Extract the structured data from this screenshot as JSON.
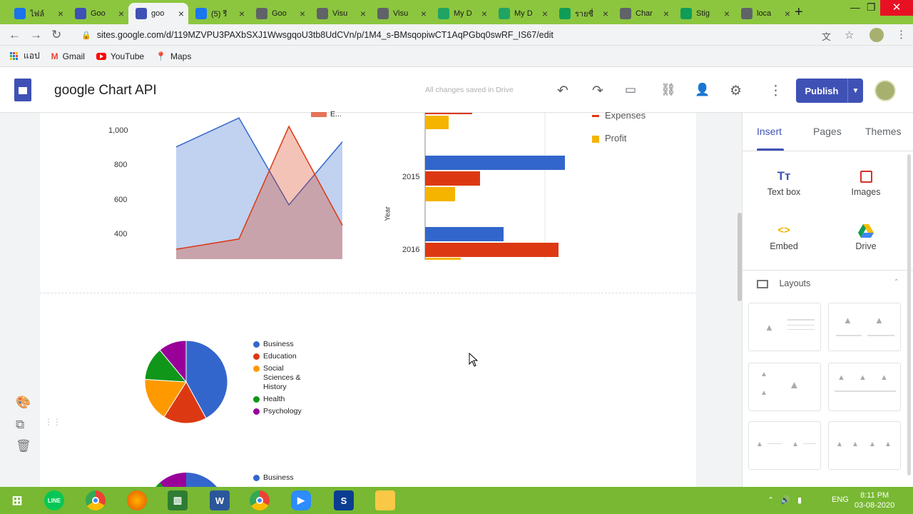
{
  "browser": {
    "tabs": [
      {
        "label": "ไฟล์",
        "fav_color": "#1a73e8",
        "icon": "sites-icon"
      },
      {
        "label": "Goo",
        "fav_color": "#3f51b5",
        "icon": "sites-icon"
      },
      {
        "label": "goo",
        "fav_color": "#3f51b5",
        "icon": "sites-icon",
        "active": true
      },
      {
        "label": "(5) รี",
        "fav_color": "#1877f2",
        "icon": "facebook-icon"
      },
      {
        "label": "Goo",
        "fav_color": "#5f6368",
        "icon": "code-icon"
      },
      {
        "label": "Visu",
        "fav_color": "#5f6368",
        "icon": "code-icon"
      },
      {
        "label": "Visu",
        "fav_color": "#5f6368",
        "icon": "code-icon"
      },
      {
        "label": "My D",
        "fav_color": "#1fa463",
        "icon": "drive-icon"
      },
      {
        "label": "My D",
        "fav_color": "#1fa463",
        "icon": "drive-icon"
      },
      {
        "label": "รายชื่",
        "fav_color": "#0f9d58",
        "icon": "sheets-icon"
      },
      {
        "label": "Char",
        "fav_color": "#5f6368",
        "icon": "code-icon"
      },
      {
        "label": "Stig",
        "fav_color": "#0f9d58",
        "icon": "sheets-icon"
      },
      {
        "label": "loca",
        "fav_color": "#5f6368",
        "icon": "globe-icon"
      }
    ],
    "url": "sites.google.com/d/119MZVPU3PAXbSXJ1WwsgqoU3tb8UdCVn/p/1M4_s-BMsqopiwCT1AqPGbq0swRF_IS67/edit",
    "bookmarks": [
      {
        "label": "แอป"
      },
      {
        "label": "Gmail"
      },
      {
        "label": "YouTube"
      },
      {
        "label": "Maps"
      }
    ]
  },
  "sites": {
    "title": "google Chart API",
    "saved_status": "All changes saved in Drive",
    "publish_label": "Publish"
  },
  "charts": {
    "area_ticks": [
      "1,000",
      "800",
      "600",
      "400"
    ],
    "area_legend_partial": "E...",
    "bar_legend": [
      "Expenses",
      "Profit"
    ],
    "bar_ticks": [
      "2015",
      "2016"
    ],
    "bar_axis_label": "Year",
    "pie_legend": [
      {
        "label": "Business",
        "color": "#3366cc"
      },
      {
        "label": "Education",
        "color": "#dc3912"
      },
      {
        "label": "Social Sciences & History",
        "color": "#ff9900"
      },
      {
        "label": "Health",
        "color": "#109618"
      },
      {
        "label": "Psychology",
        "color": "#990099"
      }
    ],
    "pie2_legend_first": "Business"
  },
  "chart_data": [
    {
      "type": "area",
      "ylim": [
        300,
        1200
      ],
      "x": [
        1,
        2,
        3,
        4,
        5
      ],
      "series": [
        {
          "values": [
            1000,
            1170,
            660,
            1030
          ],
          "color": "#3366cc"
        },
        {
          "values": [
            400,
            460,
            1120,
            540
          ],
          "color": "#dc3912"
        }
      ],
      "legend": [
        "E..."
      ]
    },
    {
      "type": "bar",
      "categories": [
        "2015",
        "2016"
      ],
      "ylabel": "Year",
      "legend": [
        "Expenses",
        "Profit"
      ],
      "series_colors": [
        "#3366cc",
        "#dc3912",
        "#ff9900"
      ]
    },
    {
      "type": "pie",
      "categories": [
        "Business",
        "Education",
        "Social Sciences & History",
        "Health",
        "Psychology"
      ],
      "values": [
        42,
        17,
        17,
        13,
        11
      ]
    }
  ],
  "panel": {
    "tabs": [
      "Insert",
      "Pages",
      "Themes"
    ],
    "items": [
      {
        "label": "Text box",
        "icon": "text-box-icon"
      },
      {
        "label": "Images",
        "icon": "images-icon"
      },
      {
        "label": "Embed",
        "icon": "embed-icon"
      },
      {
        "label": "Drive",
        "icon": "drive-icon"
      }
    ],
    "layouts_label": "Layouts"
  },
  "taskbar": {
    "lang": "ENG",
    "time": "8:11 PM",
    "date": "03-08-2020"
  },
  "colors": {
    "accent": "#3f51b5",
    "tab_strip": "#8cc63f",
    "taskbar": "#78b833"
  }
}
